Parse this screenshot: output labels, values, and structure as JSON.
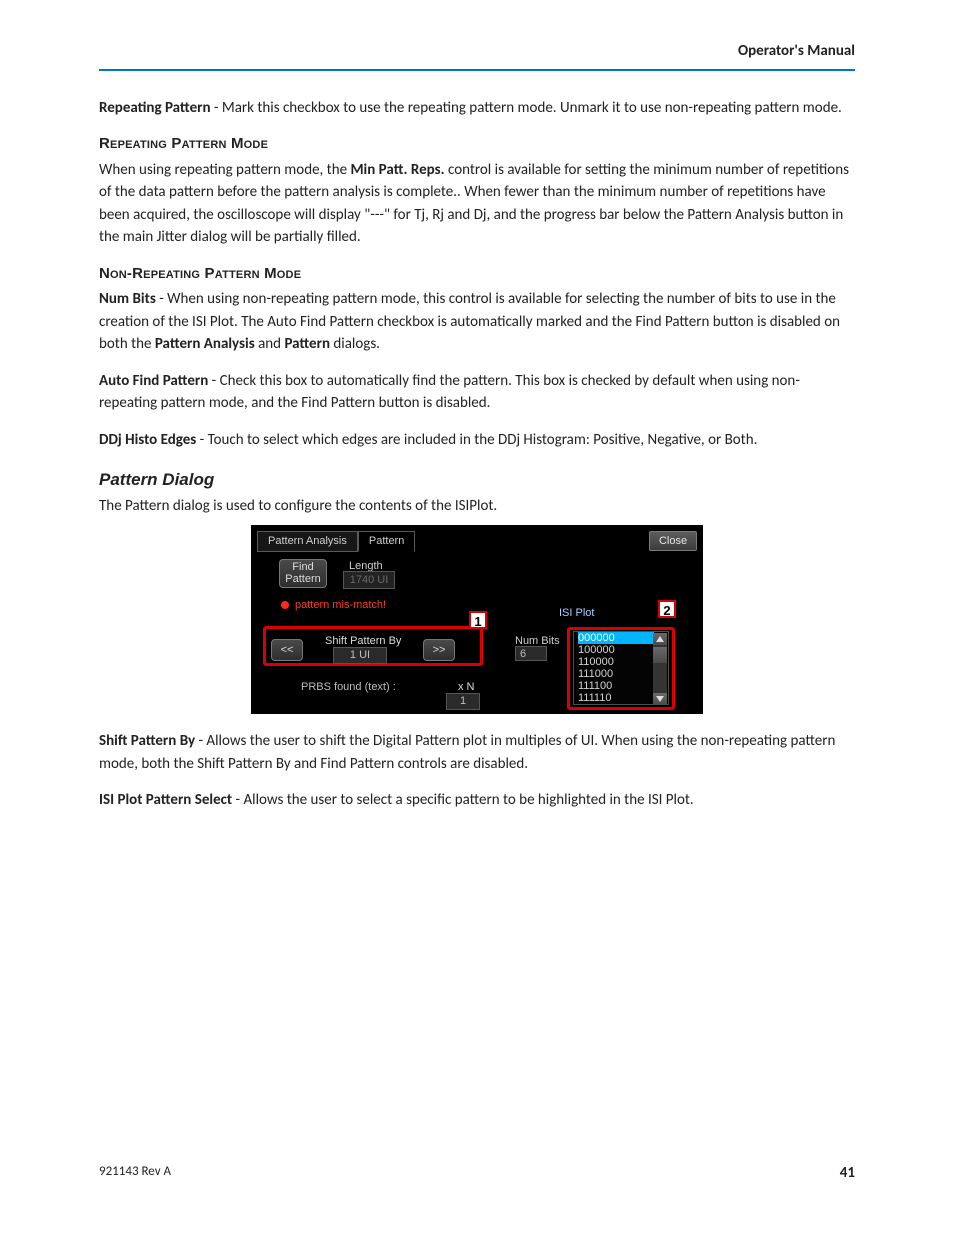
{
  "header": {
    "title": "Operator's Manual"
  },
  "body": {
    "p1_bold": "Repeating Pattern",
    "p1_rest": " - Mark this checkbox to use the repeating pattern mode. Unmark it to use non-repeating pattern mode.",
    "h1": "Repeating Pattern Mode",
    "p2a": "When using repeating pattern mode, the ",
    "p2b": "Min Patt. Reps.",
    "p2c": " control is available for setting the minimum number of repetitions of the data pattern before the pattern analysis is complete.. When fewer than the minimum number of repetitions have been acquired, the oscilloscope will display \"---\" for Tj, Rj and Dj, and the progress bar below the Pattern Analysis button in the main Jitter dialog will be partially filled.",
    "h2": "Non-Repeating Pattern Mode",
    "p3a": "Num Bits",
    "p3b": " - When using non-repeating pattern mode, this control is available for selecting the number of bits to use in the creation of the ISI Plot. The Auto Find Pattern checkbox is automatically marked and the Find Pattern button is disabled on both the ",
    "p3c": "Pattern Analysis",
    "p3d": " and ",
    "p3e": "Pattern",
    "p3f": " dialogs.",
    "p4a": "Auto Find Pattern",
    "p4b": " - Check this box to automatically find the pattern. This box is checked by default when using non-repeating pattern mode, and the Find Pattern button is disabled.",
    "p5a": "DDj Histo Edges",
    "p5b": " - Touch to select which edges are included in the DDj Histogram: Positive, Negative, or Both.",
    "h3": "Pattern Dialog",
    "p6": "The Pattern dialog is used to configure the contents of the ISIPlot.",
    "p7a": "Shift Pattern By",
    "p7b": " - Allows the user to shift the Digital Pattern plot in multiples of UI. When using the non-repeating pattern mode, both the Shift Pattern By and Find Pattern controls are disabled.",
    "p8a": "ISI Plot Pattern Select",
    "p8b": " - Allows the user to select a specific pattern to be highlighted in the ISI Plot."
  },
  "figure": {
    "tab1": "Pattern Analysis",
    "tab2": "Pattern",
    "close": "Close",
    "find_line1": "Find",
    "find_line2": "Pattern",
    "length_label": "Length",
    "length_value": "1740 UI",
    "mismatch": "pattern mis-match!",
    "callout1": "1",
    "callout2": "2",
    "shift_label": "Shift Pattern By",
    "shift_value": "1 UI",
    "btn_left": "<<",
    "btn_right": ">>",
    "prbs_label": "PRBS found (text) :",
    "xn_label": "x N",
    "xn_value": "1",
    "isi_label": "ISI Plot",
    "numbits_label": "Num Bits",
    "numbits_value": "6",
    "list": [
      "000000",
      "100000",
      "110000",
      "111000",
      "111100",
      "111110"
    ]
  },
  "footer": {
    "rev": "921143 Rev A",
    "page": "41"
  }
}
